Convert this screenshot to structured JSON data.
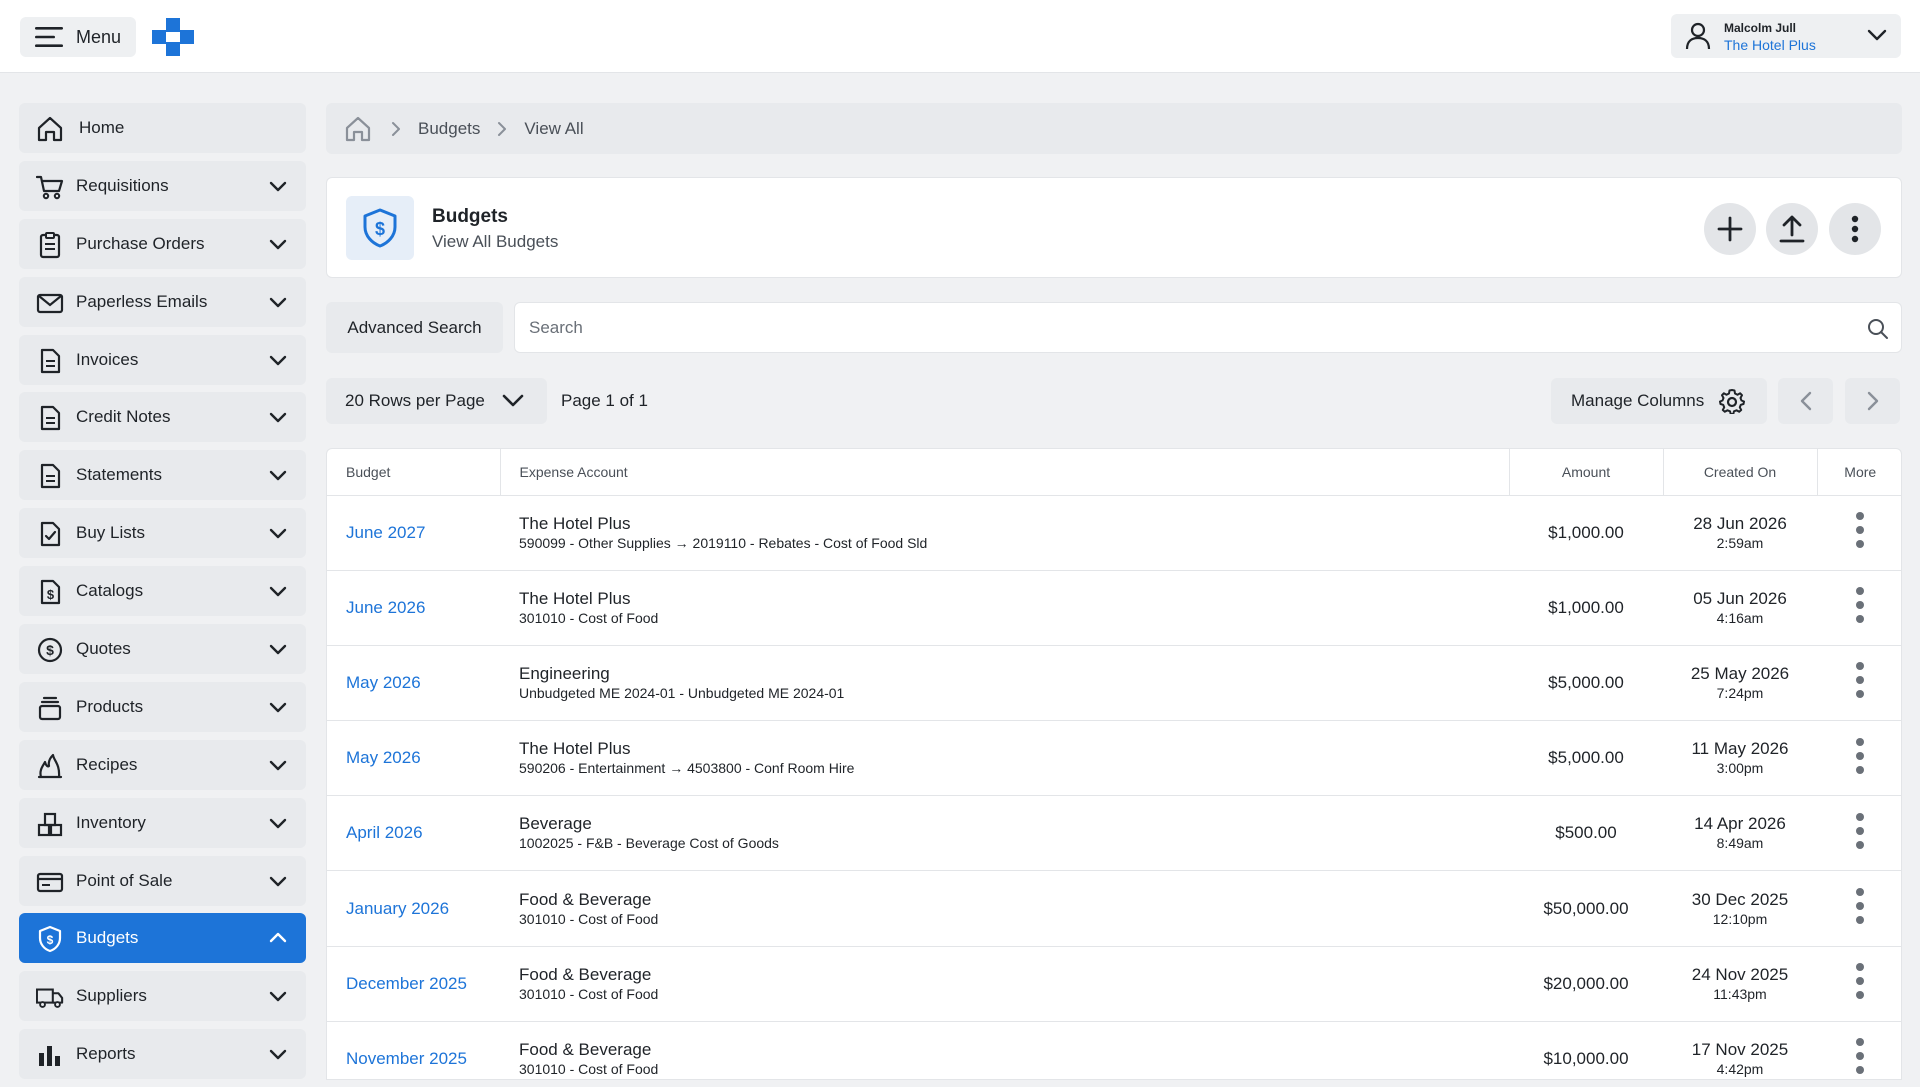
{
  "topbar": {
    "menu_label": "Menu",
    "user_name": "Malcolm Jull",
    "user_org": "The Hotel Plus"
  },
  "sidebar": {
    "items": [
      {
        "label": "Home",
        "icon": "home-icon"
      },
      {
        "label": "Requisitions",
        "icon": "cart-icon"
      },
      {
        "label": "Purchase Orders",
        "icon": "clipboard-icon"
      },
      {
        "label": "Paperless Emails",
        "icon": "envelope-icon"
      },
      {
        "label": "Invoices",
        "icon": "document-icon"
      },
      {
        "label": "Credit Notes",
        "icon": "document-icon"
      },
      {
        "label": "Statements",
        "icon": "document-icon"
      },
      {
        "label": "Buy Lists",
        "icon": "checklist-icon"
      },
      {
        "label": "Catalogs",
        "icon": "dollar-document-icon"
      },
      {
        "label": "Quotes",
        "icon": "dollar-circle-icon"
      },
      {
        "label": "Products",
        "icon": "stack-icon"
      },
      {
        "label": "Recipes",
        "icon": "flame-icon"
      },
      {
        "label": "Inventory",
        "icon": "boxes-icon"
      },
      {
        "label": "Point of Sale",
        "icon": "credit-card-icon"
      },
      {
        "label": "Budgets",
        "icon": "shield-dollar-icon",
        "active": true
      },
      {
        "label": "Suppliers",
        "icon": "truck-icon"
      },
      {
        "label": "Reports",
        "icon": "bar-chart-icon"
      }
    ]
  },
  "breadcrumb": {
    "items": [
      "Budgets",
      "View All"
    ]
  },
  "header": {
    "title": "Budgets",
    "subtitle": "View All Budgets"
  },
  "search": {
    "advanced_label": "Advanced Search",
    "placeholder": "Search"
  },
  "pager": {
    "rows_per_page": "20 Rows per Page",
    "page_info": "Page 1 of 1",
    "manage_columns": "Manage Columns"
  },
  "table": {
    "headers": [
      "Budget",
      "Expense Account",
      "Amount",
      "Created On",
      "More"
    ],
    "rows": [
      {
        "budget": "June 2027",
        "account": "The Hotel Plus",
        "detail": "590099 - Other Supplies → 2019110 - Rebates - Cost of Food Sld",
        "amount": "$1,000.00",
        "date": "28 Jun 2026",
        "time": "2:59am"
      },
      {
        "budget": "June 2026",
        "account": "The Hotel Plus",
        "detail": "301010 - Cost of Food",
        "amount": "$1,000.00",
        "date": "05 Jun 2026",
        "time": "4:16am"
      },
      {
        "budget": "May 2026",
        "account": "Engineering",
        "detail": "Unbudgeted ME 2024-01 - Unbudgeted ME 2024-01",
        "amount": "$5,000.00",
        "date": "25 May 2026",
        "time": "7:24pm"
      },
      {
        "budget": "May 2026",
        "account": "The Hotel Plus",
        "detail": "590206 - Entertainment → 4503800 - Conf Room Hire",
        "amount": "$5,000.00",
        "date": "11 May 2026",
        "time": "3:00pm"
      },
      {
        "budget": "April 2026",
        "account": "Beverage",
        "detail": "1002025 - F&B - Beverage Cost of Goods",
        "amount": "$500.00",
        "date": "14 Apr 2026",
        "time": "8:49am"
      },
      {
        "budget": "January 2026",
        "account": "Food & Beverage",
        "detail": "301010 - Cost of Food",
        "amount": "$50,000.00",
        "date": "30 Dec 2025",
        "time": "12:10pm"
      },
      {
        "budget": "December 2025",
        "account": "Food & Beverage",
        "detail": "301010 - Cost of Food",
        "amount": "$20,000.00",
        "date": "24 Nov 2025",
        "time": "11:43pm"
      },
      {
        "budget": "November 2025",
        "account": "Food & Beverage",
        "detail": "301010 - Cost of Food",
        "amount": "$10,000.00",
        "date": "17 Nov 2025",
        "time": "4:42pm"
      }
    ]
  },
  "colors": {
    "accent": "#1d74d8",
    "surface": "#e8eaed",
    "background": "#f0f1f3"
  }
}
